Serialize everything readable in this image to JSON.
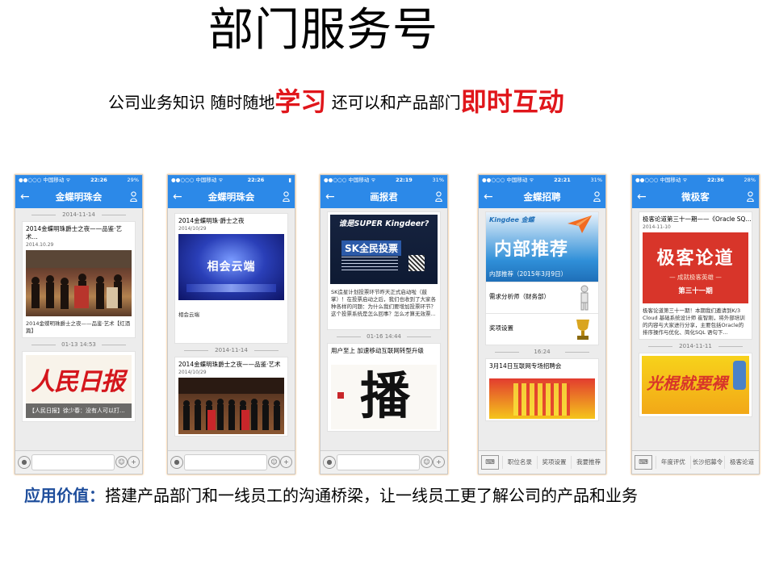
{
  "slide": {
    "title": "部门服务号",
    "subtitle_parts": [
      "公司业务知识  随时随地",
      "学习",
      "  还可以和产品部门",
      "即时互动"
    ],
    "footer_label": "应用价值：",
    "footer_text": "搭建产品部门和一线员工的沟通桥梁，让一线员工更了解公司的产品和业务"
  },
  "colors": {
    "accent": "#e0161b",
    "nav_blue": "#2c89e8",
    "footer_blue": "#1f4e9c"
  },
  "phones": [
    {
      "carrier": "●●○○○ 中国移动 ᯤ",
      "time": "22:26",
      "battery": "29%",
      "nav_title": "金蝶明珠会",
      "ts1": "2014-11-14",
      "card1_title": "2014金蝶明珠爵士之夜——品鉴·艺术...",
      "card1_date": "2014.10.29",
      "card1_text": "2014金蝶明珠爵士之夜——品鉴·艺术【红酒篇】",
      "ts2": "01-13 14:53",
      "card2_logo": "人民日报",
      "card2_caption": "【人民日报】徐少春：没有人可以打..."
    },
    {
      "carrier": "●●○○○ 中国移动 ᯤ",
      "time": "22:26",
      "battery": "",
      "nav_title": "金蝶明珠会",
      "card1_title": "2014金蝶明珠·爵士之夜",
      "card1_date": "2014/10/29",
      "card1_banner": "相会云端",
      "card1_text": "相会云端",
      "ts1": "2014-11-14",
      "card2_title": "2014金蝶明珠爵士之夜——品鉴·艺术",
      "card2_date": "2014/10/29"
    },
    {
      "carrier": "●●○○○ 中国移动 ᯤ",
      "time": "22:19",
      "battery": "31%",
      "nav_title": "画报君",
      "poster_head": "谁是SUPER Kingdeer?",
      "poster_banner": "SK全民投票",
      "card1_text": "SK造星计划投票环节昨天正式启动啦（鼓掌）！在投票启动之后，我们也收到了大家各种各样的问题：为什么我们要增加投票环节？这个投票系统是怎么回事？怎么才算无效票...",
      "ts1": "01-16 14:44",
      "card2_title": "用户至上 加速移动互联网转型升级",
      "card2_calligraphy": "播"
    },
    {
      "carrier": "●●○○○ 中国移动 ᯤ",
      "time": "22:21",
      "battery": "31%",
      "nav_title": "金蝶招聘",
      "brand": "Kingdee 金蝶",
      "banner_text": "内部推荐",
      "banner_caption": "内部推荐（2015年3月9日）",
      "item1": "需求分析师（财务部）",
      "item2": "奖项设置",
      "ts1": "16:24",
      "card2_title": "3月14日互联网专场招聘会",
      "menu": [
        "职位名录",
        "奖项设置",
        "我要推荐"
      ]
    },
    {
      "carrier": "●●○○○ 中国移动 ᯤ",
      "time": "22:36",
      "battery": "28%",
      "nav_title": "微极客",
      "card1_title": "极客论道第三十一期——《Oracle SQ...",
      "card1_date": "2014-11-10",
      "banner_text": "极客论道",
      "banner_sub": "— 成就极客英雄 —",
      "banner_issue": "第三十一期",
      "card1_text": "极客论道第三十一期！本期我们邀请到K/3 Cloud 基础系统设计师 崔智刚，将外部培训的内容与大家进行分享，主要包括Oracle的排序操作与优化、简化SQL 语句下...",
      "ts1": "2014-11-11",
      "card2_banner": "光棍就要裸",
      "menu": [
        "年度评优",
        "长沙招募令",
        "极客论道"
      ]
    }
  ]
}
